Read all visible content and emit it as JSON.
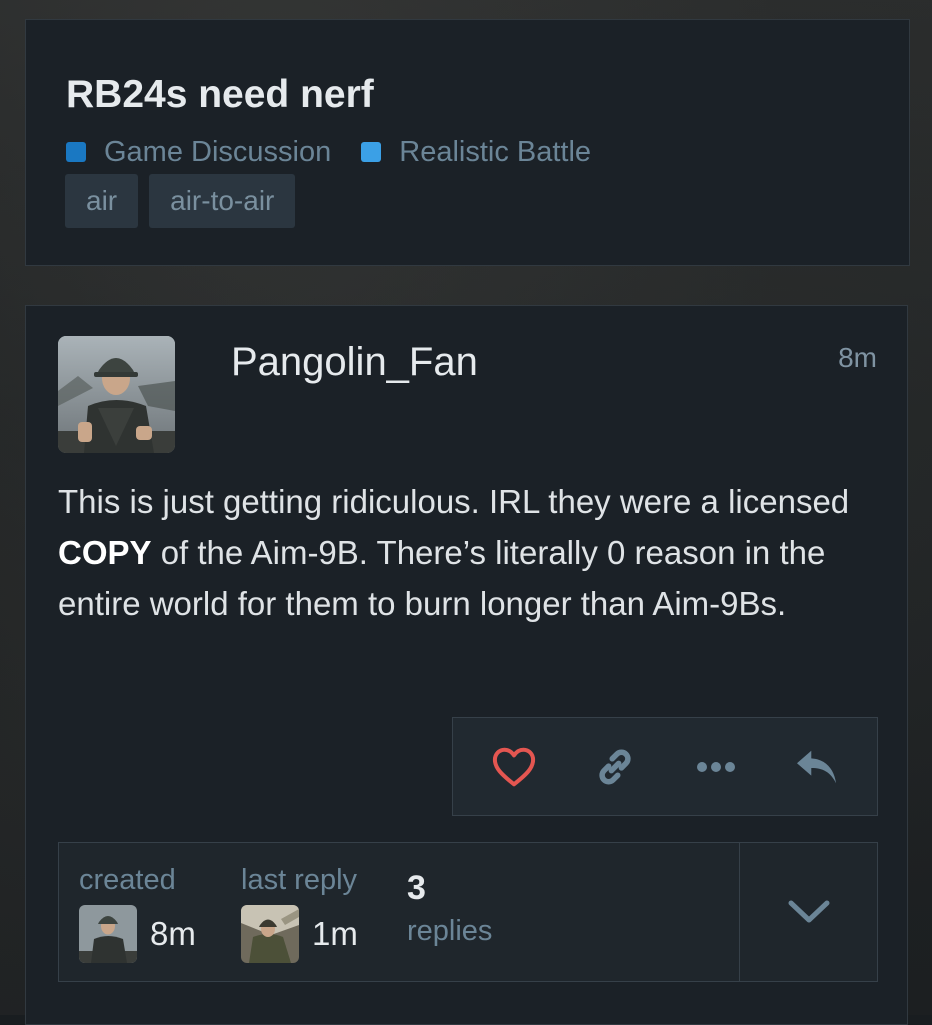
{
  "topic": {
    "title": "RB24s need nerf",
    "categories": [
      {
        "label": "Game Discussion",
        "color": "#1a78c2"
      },
      {
        "label": "Realistic Battle",
        "color": "#3ba0e6"
      }
    ],
    "tags": [
      "air",
      "air-to-air"
    ]
  },
  "post": {
    "username": "Pangolin_Fan",
    "time": "8m",
    "body": {
      "part1": "This is just getting ridiculous. IRL they were a licensed ",
      "emphasis": "COPY",
      "part2": " of the Aim-9B. There’s literally 0 reason in the entire world for them to burn longer than Aim-9Bs."
    },
    "actions": [
      {
        "name": "like",
        "icon": "heart-icon",
        "color": "#e45651"
      },
      {
        "name": "copy-link",
        "icon": "link-icon",
        "color": "#6b8597"
      },
      {
        "name": "more",
        "icon": "more-icon",
        "color": "#6b8597"
      },
      {
        "name": "reply",
        "icon": "reply-icon",
        "color": "#6b8597"
      }
    ]
  },
  "topic_map": {
    "created": {
      "label": "created",
      "value": "8m"
    },
    "last_reply": {
      "label": "last reply",
      "value": "1m"
    },
    "replies": {
      "count": "3",
      "label": "replies"
    }
  }
}
